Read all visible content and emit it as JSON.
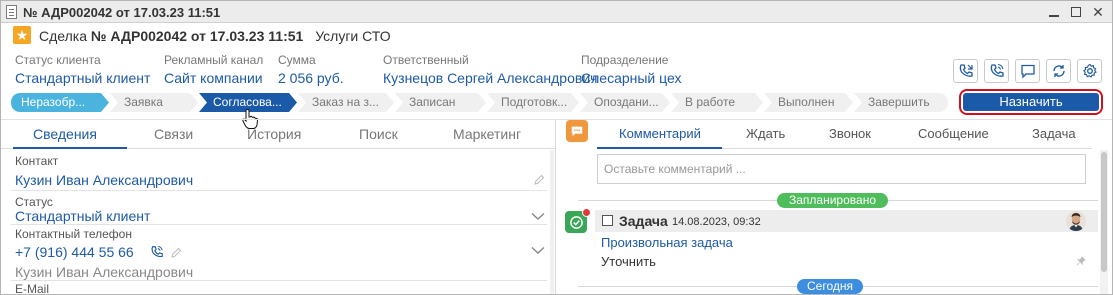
{
  "window": {
    "title": "№ АДР002042 от 17.03.23 11:51"
  },
  "header": {
    "prefix": "Сделка",
    "number": "№ АДР002042 от 17.03.23 11:51",
    "service": "Услуги СТО"
  },
  "info": {
    "client_status": {
      "label": "Статус клиента",
      "value": "Стандартный клиент"
    },
    "channel": {
      "label": "Рекламный канал",
      "value": "Сайт компании"
    },
    "sum": {
      "label": "Сумма",
      "value": "2 056 руб."
    },
    "responsible": {
      "label": "Ответственный",
      "value": "Кузнецов Сергей Александрович"
    },
    "department": {
      "label": "Подразделение",
      "value": "Слесарный цех"
    }
  },
  "toolbar": {
    "icons": [
      "phone-in-icon",
      "phone-out-icon",
      "message-icon",
      "refresh-icon",
      "settings-icon"
    ]
  },
  "stages": [
    {
      "label": "Неразобр...",
      "state": "done"
    },
    {
      "label": "Заявка",
      "state": "pending"
    },
    {
      "label": "Согласова...",
      "state": "current"
    },
    {
      "label": "Заказ на з...",
      "state": "pending"
    },
    {
      "label": "Записан",
      "state": "pending"
    },
    {
      "label": "Подготовк...",
      "state": "pending"
    },
    {
      "label": "Опоздани...",
      "state": "pending"
    },
    {
      "label": "В работе",
      "state": "pending"
    },
    {
      "label": "Выполнен",
      "state": "pending"
    },
    {
      "label": "Завершить",
      "state": "pending"
    }
  ],
  "assign_button": "Назначить",
  "left_tabs": [
    "Сведения",
    "Связи",
    "История",
    "Поиск",
    "Маркетинг"
  ],
  "fields": {
    "contact": {
      "label": "Контакт",
      "value": "Кузин Иван Александрович"
    },
    "status": {
      "label": "Статус",
      "value": "Стандартный клиент"
    },
    "phone": {
      "label": "Контактный телефон",
      "value": "+7 (916) 444 55 66",
      "owner": "Кузин Иван Александрович"
    },
    "email": {
      "label": "E-Mail"
    }
  },
  "right_tabs": [
    "Комментарий",
    "Ждать",
    "Звонок",
    "Сообщение",
    "Задача"
  ],
  "comment_placeholder": "Оставьте комментарий ...",
  "timeline": {
    "planned_label": "Запланировано",
    "today_label": "Сегодня"
  },
  "task": {
    "title": "Задача",
    "date": "14.08.2023, 09:32",
    "link": "Произвольная задача",
    "note": "Уточнить",
    "badge_count": "1"
  },
  "colors": {
    "accent": "#1a5aa8",
    "link": "#1e5aa6",
    "stage_done": "#4bb4de",
    "deal_icon": "#f5a623",
    "comment_icon": "#f0963c",
    "task_icon": "#3aa657",
    "planned_pill": "#4fbd5b",
    "today_pill": "#3d8ee0",
    "highlight_border": "#d0111b"
  }
}
